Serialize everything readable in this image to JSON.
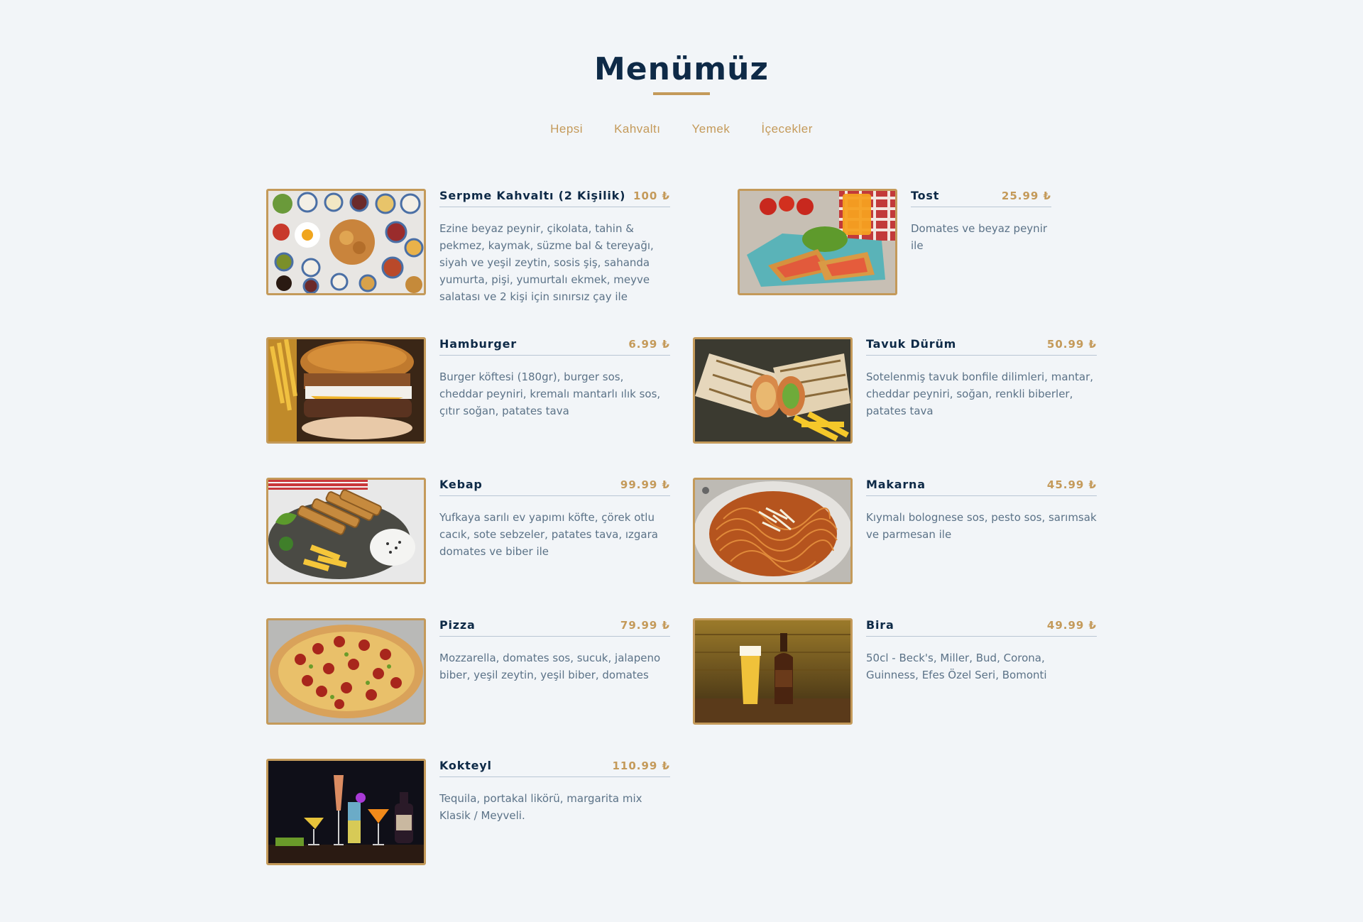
{
  "header": {
    "title": "Menümüz"
  },
  "filters": [
    "Hepsi",
    "Kahvaltı",
    "Yemek",
    "İçecekler"
  ],
  "colors": {
    "accent": "#c49a5a",
    "heading": "#0e2a47",
    "text": "#5b7287",
    "background": "#f2f5f8"
  },
  "items": [
    {
      "name": "Serpme Kahvaltı (2 Kişilik)",
      "price": "100 ₺",
      "description": "Ezine beyaz peynir, çikolata, tahin & pekmez, kaymak, süzme bal & tereyağı, siyah ve yeşil zeytin, sosis şiş, sahanda yumurta, pişi, yumurtalı ekmek, meyve salatası ve 2 kişi için sınırsız çay ile",
      "image": "breakfast-spread-photo"
    },
    {
      "name": "Tost",
      "price": "25.99 ₺",
      "description": "Domates ve beyaz peynir ile",
      "image": "toast-sandwich-photo"
    },
    {
      "name": "Hamburger",
      "price": "6.99 ₺",
      "description": "Burger köftesi (180gr), burger sos, cheddar peyniri, kremalı mantarlı ılık sos, çıtır soğan, patates tava",
      "image": "hamburger-photo"
    },
    {
      "name": "Tavuk Dürüm",
      "price": "50.99 ₺",
      "description": "Sotelenmiş tavuk bonfile dilimleri, mantar, cheddar peyniri, soğan, renkli biberler, patates tava",
      "image": "chicken-wrap-photo"
    },
    {
      "name": "Kebap",
      "price": "99.99 ₺",
      "description": "Yufkaya sarılı ev yapımı köfte, çörek otlu cacık, sote sebzeler, patates tava, ızgara domates ve biber ile",
      "image": "kebab-plate-photo"
    },
    {
      "name": "Makarna",
      "price": "45.99 ₺",
      "description": "Kıymalı bolognese sos, pesto sos, sarımsak ve parmesan ile",
      "image": "pasta-photo"
    },
    {
      "name": "Pizza",
      "price": "79.99 ₺",
      "description": "Mozzarella, domates sos, sucuk, jalapeno biber, yeşil zeytin, yeşil biber, domates",
      "image": "pizza-photo"
    },
    {
      "name": "Bira",
      "price": "49.99 ₺",
      "description": "50cl - Beck's, Miller, Bud, Corona, Guinness, Efes Özel Seri, Bomonti",
      "image": "beer-photo"
    },
    {
      "name": "Kokteyl",
      "price": "110.99 ₺",
      "description": "Tequila, portakal likörü, margarita mix Klasik / Meyveli.",
      "image": "cocktails-photo"
    }
  ]
}
